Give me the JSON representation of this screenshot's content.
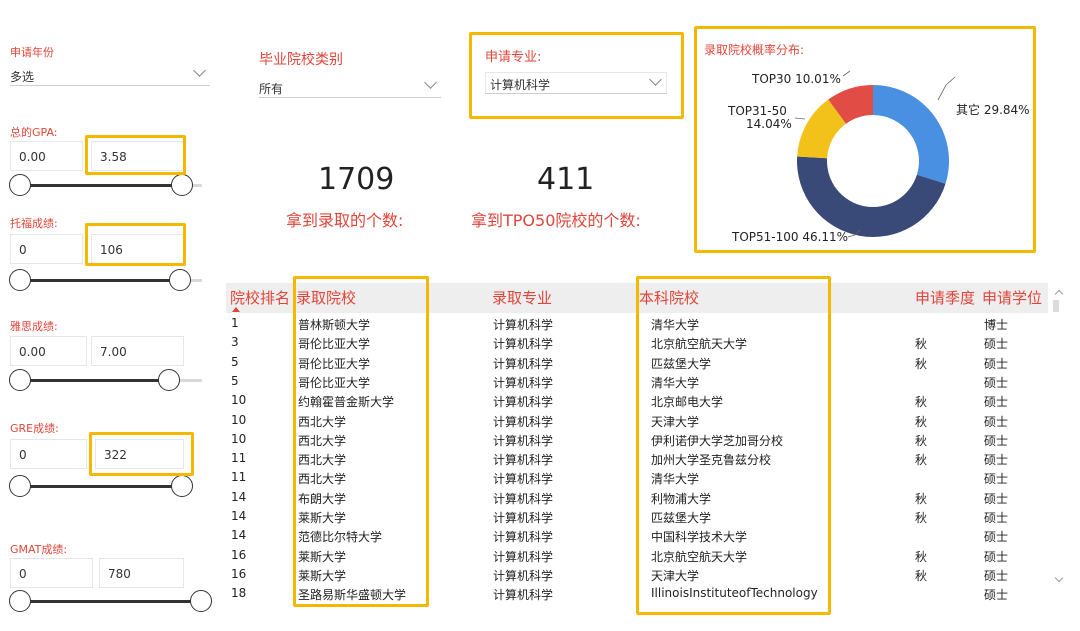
{
  "filters": {
    "year": {
      "label": "申请年份",
      "value": "多选"
    },
    "school_type": {
      "label": "毕业院校类别",
      "value": "所有"
    },
    "major": {
      "label": "申请专业:",
      "value": "计算机科学"
    },
    "gpa": {
      "label": "总的GPA:",
      "min": "0.00",
      "max": "3.58"
    },
    "toefl": {
      "label": "托福成绩:",
      "min": "0",
      "max": "106"
    },
    "ielts": {
      "label": "雅思成绩:",
      "min": "0.00",
      "max": "7.00"
    },
    "gre": {
      "label": "GRE成绩:",
      "min": "0",
      "max": "322"
    },
    "gmat": {
      "label": "GMAT成绩:",
      "min": "0",
      "max": "780"
    }
  },
  "cards": {
    "admits": {
      "value": "1709",
      "label": "拿到录取的个数:"
    },
    "top50": {
      "value": "411",
      "label": "拿到TPO50院校的个数:"
    }
  },
  "donut": {
    "title": "录取院校概率分布:",
    "slices": [
      {
        "name": "其它",
        "label": "其它 29.84%",
        "value": 29.84,
        "color": "#4a90e2"
      },
      {
        "name": "TOP51-100",
        "label": "TOP51-100 46.11%",
        "value": 46.11,
        "color": "#3a4a78"
      },
      {
        "name": "TOP31-50",
        "label_line1": "TOP31-50",
        "label_line2": "14.04%",
        "value": 14.04,
        "color": "#f2c21b"
      },
      {
        "name": "TOP30",
        "label": "TOP30 10.01%",
        "value": 10.01,
        "color": "#e14d44"
      }
    ]
  },
  "table": {
    "headers": [
      "院校排名",
      "录取院校",
      "录取专业",
      "本科院校",
      "申请季度",
      "申请学位"
    ],
    "rows": [
      [
        "1",
        "普林斯顿大学",
        "计算机科学",
        "清华大学",
        "",
        "博士"
      ],
      [
        "3",
        "哥伦比亚大学",
        "计算机科学",
        "北京航空航天大学",
        "秋",
        "硕士"
      ],
      [
        "5",
        "哥伦比亚大学",
        "计算机科学",
        "匹兹堡大学",
        "秋",
        "硕士"
      ],
      [
        "5",
        "哥伦比亚大学",
        "计算机科学",
        "清华大学",
        "",
        "硕士"
      ],
      [
        "10",
        "约翰霍普金斯大学",
        "计算机科学",
        "北京邮电大学",
        "秋",
        "硕士"
      ],
      [
        "10",
        "西北大学",
        "计算机科学",
        "天津大学",
        "秋",
        "硕士"
      ],
      [
        "10",
        "西北大学",
        "计算机科学",
        "伊利诺伊大学芝加哥分校",
        "秋",
        "硕士"
      ],
      [
        "11",
        "西北大学",
        "计算机科学",
        "加州大学圣克鲁兹分校",
        "秋",
        "硕士"
      ],
      [
        "11",
        "西北大学",
        "计算机科学",
        "清华大学",
        "",
        "硕士"
      ],
      [
        "14",
        "布朗大学",
        "计算机科学",
        "利物浦大学",
        "秋",
        "硕士"
      ],
      [
        "14",
        "莱斯大学",
        "计算机科学",
        "匹兹堡大学",
        "秋",
        "硕士"
      ],
      [
        "14",
        "范德比尔特大学",
        "计算机科学",
        "中国科学技术大学",
        "",
        "硕士"
      ],
      [
        "16",
        "莱斯大学",
        "计算机科学",
        "北京航空航天大学",
        "秋",
        "硕士"
      ],
      [
        "16",
        "莱斯大学",
        "计算机科学",
        "天津大学",
        "秋",
        "硕士"
      ],
      [
        "18",
        "圣路易斯华盛顿大学",
        "计算机科学",
        "IllinoisInstituteofTechnology",
        "",
        "硕士"
      ]
    ]
  }
}
